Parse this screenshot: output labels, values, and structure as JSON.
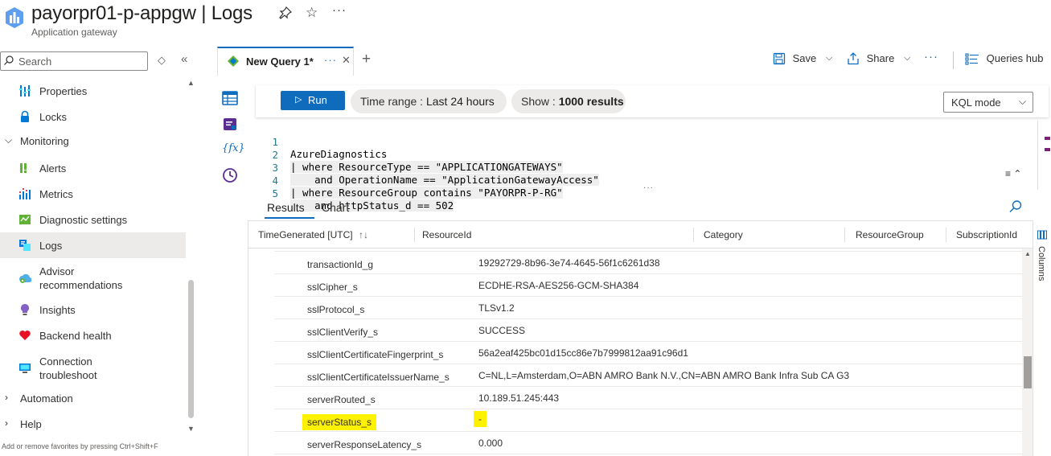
{
  "header": {
    "title": "payorpr01-p-appgw | Logs",
    "subtitle": "Application gateway",
    "icons": [
      "pin-icon",
      "star-icon",
      "more-icon"
    ]
  },
  "sidebar": {
    "search_placeholder": "Search",
    "items": [
      {
        "label": "Properties",
        "icon": "properties-icon"
      },
      {
        "label": "Locks",
        "icon": "lock-icon"
      },
      {
        "label": "Monitoring",
        "group": true,
        "expanded": true
      },
      {
        "label": "Alerts",
        "icon": "alert-icon"
      },
      {
        "label": "Metrics",
        "icon": "metrics-icon"
      },
      {
        "label": "Diagnostic settings",
        "icon": "diagnostic-icon"
      },
      {
        "label": "Logs",
        "icon": "logs-icon",
        "selected": true
      },
      {
        "label": "Advisor recommendations",
        "icon": "advisor-icon"
      },
      {
        "label": "Insights",
        "icon": "insights-icon"
      },
      {
        "label": "Backend health",
        "icon": "heart-icon"
      },
      {
        "label": "Connection troubleshoot",
        "icon": "monitor-icon"
      },
      {
        "label": "Automation",
        "group": true,
        "expanded": false
      },
      {
        "label": "Help",
        "group": true,
        "expanded": false
      }
    ],
    "hint": "Add or remove favorites by pressing Ctrl+Shift+F"
  },
  "tabbar": {
    "tab_label": "New Query 1*",
    "save_label": "Save",
    "share_label": "Share",
    "queries_hub_label": "Queries hub"
  },
  "toolbar": {
    "run_label": "Run",
    "time_range_prefix": "Time range : ",
    "time_range_value": "Last 24 hours",
    "show_prefix": "Show : ",
    "show_value": "1000 results",
    "mode_label": "KQL mode"
  },
  "editor": {
    "line_numbers": [
      "1",
      "2",
      "3",
      "4",
      "5"
    ],
    "lines": [
      "AzureDiagnostics",
      "| where ResourceType == \"APPLICATIONGATEWAYS\"",
      "    and OperationName == \"ApplicationGatewayAccess\"",
      "| where ResourceGroup contains \"PAYORPR-P-RG\"",
      "    and httpStatus_d == 502"
    ]
  },
  "results": {
    "tabs": [
      "Results",
      "Chart"
    ],
    "columns": [
      "TimeGenerated [UTC]",
      "ResourceId",
      "Category",
      "ResourceGroup",
      "SubscriptionId"
    ],
    "columns_panel_label": "Columns",
    "rows": [
      {
        "key": "transactionId_g",
        "value": "19292729-8b96-3e74-4645-56f1c6261d38"
      },
      {
        "key": "sslCipher_s",
        "value": "ECDHE-RSA-AES256-GCM-SHA384"
      },
      {
        "key": "sslProtocol_s",
        "value": "TLSv1.2"
      },
      {
        "key": "sslClientVerify_s",
        "value": "SUCCESS"
      },
      {
        "key": "sslClientCertificateFingerprint_s",
        "value": "56a2eaf425bc01d15cc86e7b7999812aa91c96d1"
      },
      {
        "key": "sslClientCertificateIssuerName_s",
        "value": "C=NL,L=Amsterdam,O=ABN AMRO Bank N.V.,CN=ABN AMRO Bank Infra Sub CA G3"
      },
      {
        "key": "serverRouted_s",
        "value": "10.189.51.245:443"
      },
      {
        "key": "serverStatus_s",
        "value": "-",
        "highlight": true
      },
      {
        "key": "serverResponseLatency_s",
        "value": "0.000"
      }
    ]
  },
  "colors": {
    "accent": "#0f6cbd",
    "highlight": "#fff200",
    "selected_nav": "#edebe9"
  }
}
